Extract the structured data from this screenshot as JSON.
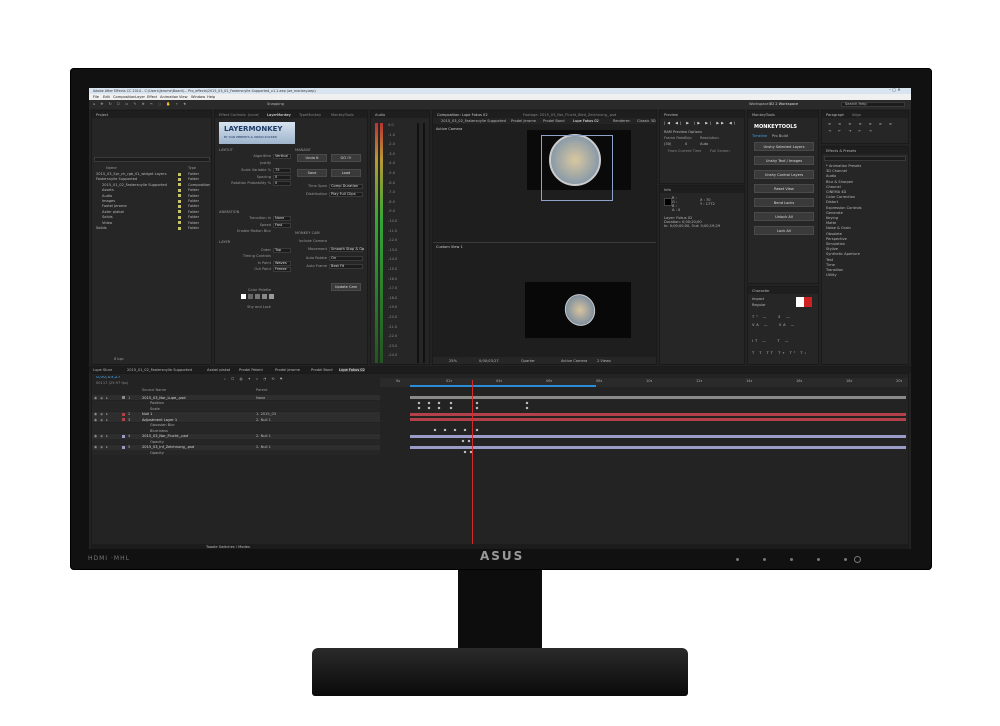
{
  "window": {
    "title": "Adobe After Effects CC 2014 - C:\\Users\\Jerome\\Board\\... Pro_effects\\2015_03_02_Fastersnylie-Supported_v1.1.aep (ae_monkey.aep)",
    "menu": [
      "File",
      "Edit",
      "Composition",
      "Layer",
      "Effect",
      "Animation",
      "View",
      "Window",
      "Help"
    ],
    "snapping": "Snapping",
    "workspace_label": "Workspace:",
    "workspace_value": "3D 2 Workspace",
    "search_help": "Search Help"
  },
  "project": {
    "tab": "Project",
    "col_name": "Name",
    "col_type": "Type",
    "items": [
      {
        "name": "2015_03_Spr_ch_rgb_01_widget Layers",
        "type": "Folder"
      },
      {
        "name": "Fastersnylie Supported",
        "type": "Folder"
      },
      {
        "name": "2015_01_02_Fastersnylie Supported",
        "type": "Composition"
      },
      {
        "name": "Assets",
        "type": "Folder"
      },
      {
        "name": "Audio",
        "type": "Folder"
      },
      {
        "name": "Images",
        "type": "Folder"
      },
      {
        "name": "Footel Jerome",
        "type": "Folder"
      },
      {
        "name": "Axter plakat",
        "type": "Folder"
      },
      {
        "name": "Solids",
        "type": "Folder"
      },
      {
        "name": "Video",
        "type": "Folder"
      },
      {
        "name": "Solids",
        "type": "Folder"
      }
    ],
    "bpc": "8 bpc"
  },
  "layermonkey": {
    "tabs": [
      "Effect Controls: (none)",
      "LayerMonkey",
      "TypeMonkey",
      "MonkeyTools"
    ],
    "logo": "LAYERMONKEY",
    "byline": "BY DAN EBBERTS & ORRIN ZUCKER",
    "sections": {
      "layout": "LAYOUT",
      "animation": "ANIMATION",
      "layer": "LAYER",
      "manage": "MANAGE",
      "monkey_cam": "MONKEY CAM"
    },
    "fields": [
      {
        "label": "Algorithm",
        "value": "Vertical"
      },
      {
        "label": "Justify",
        "value": ""
      },
      {
        "label": "Scale Variable %",
        "value": "75"
      },
      {
        "label": "Spacing",
        "value": "0"
      },
      {
        "label": "Rotation Probability %",
        "value": "0"
      },
      {
        "label": "Transition In",
        "value": "None"
      },
      {
        "label": "Speed",
        "value": "Fast"
      },
      {
        "label": "Enable Motion Blur",
        "value": ""
      },
      {
        "label": "Order",
        "value": "Top"
      },
      {
        "label": "Timing Controls",
        "value": ""
      },
      {
        "label": "In Point",
        "value": "Waves"
      },
      {
        "label": "Out Point",
        "value": "Freeze"
      },
      {
        "label": "Color Palette",
        "value": ""
      },
      {
        "label": "Shy and Lock",
        "value": ""
      }
    ],
    "buttons": [
      "Undo It",
      "GO !!!",
      "Save",
      "Load",
      "Update Cam"
    ],
    "right_fields": [
      {
        "label": "Time Span",
        "value": "Comp Duration"
      },
      {
        "label": "Distribution",
        "value": "Play Full Clips"
      },
      {
        "label": "Include Camera",
        "value": ""
      },
      {
        "label": "Movement",
        "value": "Smooth Stop & Go"
      },
      {
        "label": "Auto Rotate",
        "value": "On"
      },
      {
        "label": "Auto Frame",
        "value": "Best Fit"
      }
    ]
  },
  "audio": {
    "tab": "Audio",
    "levels": [
      "0.0",
      "-1.0",
      "-2.0",
      "-3.0",
      "-4.0",
      "-5.0",
      "-6.0",
      "-7.0",
      "-8.0",
      "-9.0",
      "-10.0",
      "-11.0",
      "-12.0",
      "-13.0",
      "-14.0",
      "-15.0",
      "-16.0",
      "-17.0",
      "-18.0",
      "-19.0",
      "-20.0",
      "-21.0",
      "-22.0",
      "-23.0",
      "-24.0"
    ]
  },
  "viewer": {
    "tab_comp": "Composition: Lupe Fokus 02",
    "tab_footage": "Footage: 2015_03_Nor_Flucht_Bled_Zeichnung_.psd",
    "sub_tabs": [
      "2015_03_02_Fastersnylie Supported",
      "Prodel Jerome",
      "Prodel Band",
      "Lupe Fokus 02"
    ],
    "renderer": "Renderer:",
    "renderer_value": "Classic 3D",
    "active_camera": "Active Camera",
    "custom_view": "Custom View 1",
    "zoom": "25%",
    "timecode": "0;00;03;27",
    "resolution": "Quarter",
    "camera": "Active Camera",
    "views": "2 Views"
  },
  "preview": {
    "tab": "Preview",
    "ram_options": "RAM Preview Options",
    "frame_rate_label": "Frame Rate",
    "skip_label": "Skip",
    "resolution_label": "Resolution",
    "frame_rate": "(30)",
    "skip": "0",
    "resolution": "Auto",
    "from_current": "From Current Time",
    "full_screen": "Full Screen"
  },
  "info": {
    "tab": "Info",
    "rgb": [
      "R :",
      "G :",
      "B :",
      "A : 0"
    ],
    "xy": [
      "X : 70",
      "Y : 1772"
    ],
    "layer": "Layer: Fokus 02",
    "duration": "Duration: 0;00;20;00",
    "inout": "In: 0;00;00;00, Out: 0;00;19;29"
  },
  "monkeytools": {
    "tab": "MonkeyTools",
    "logo": "MONKEYTOOLS",
    "tabs": [
      "Timeline",
      "Pro Build"
    ],
    "buttons": [
      "Unshy Selected Layers",
      "Unshy Text / Images",
      "Unshy Control Layers",
      "Reset View",
      "Bend Locks",
      "Unlock All",
      "Lock All"
    ]
  },
  "paragraph": {
    "tabs": [
      "Paragraph",
      "Align"
    ]
  },
  "character": {
    "tab": "Character",
    "font": "Impact",
    "style": "Regular",
    "size_items": [
      "px",
      "px",
      "px",
      "px"
    ]
  },
  "effects": {
    "tab": "Effects & Presets",
    "items": [
      "* Animation Presets",
      "3D Channel",
      "Audio",
      "Blur & Sharpen",
      "Channel",
      "CINEMA 4D",
      "Color Correction",
      "Distort",
      "Expression Controls",
      "Generate",
      "Keying",
      "Matte",
      "Noise & Grain",
      "Obsolete",
      "Perspective",
      "Simulation",
      "Stylize",
      "Synthetic Aperture",
      "Text",
      "Time",
      "Transition",
      "Utility"
    ]
  },
  "timeline": {
    "tabs": [
      "Lupe Sturz",
      "2015_01_02_Fastersnylie Supported",
      "Axstel plakat",
      "Prodel Patent",
      "Prodel Jerome",
      "Prodel Band",
      "Lupe Fokus 02"
    ],
    "timecode": "0;00;03;27",
    "fps": "00117 (29.97 fps)",
    "col_source": "Source Name",
    "col_parent": "Parent",
    "ruler": [
      "0s",
      "02s",
      "04s",
      "06s",
      "08s",
      "10s",
      "12s",
      "14s",
      "16s",
      "18s",
      "20s"
    ],
    "layers": [
      {
        "num": "1",
        "name": "2015_03_Nor_Lupe_.psd",
        "parent": "None"
      },
      {
        "num": "",
        "name": "Position",
        "parent": ""
      },
      {
        "num": "",
        "name": "Scale",
        "parent": ""
      },
      {
        "num": "2",
        "name": "Null 1",
        "parent": "1. 2015_03"
      },
      {
        "num": "3",
        "name": "Adjustment Layer 1",
        "parent": "2. Null 1"
      },
      {
        "num": "",
        "name": "Gaussian Blur",
        "parent": ""
      },
      {
        "num": "",
        "name": "Blurriness",
        "parent": ""
      },
      {
        "num": "4",
        "name": "2015_03_Nor_Flucht_.psd",
        "parent": "2. Null 1"
      },
      {
        "num": "",
        "name": "Opacity",
        "parent": ""
      },
      {
        "num": "5",
        "name": "2015_03_Inf_Zeichnung_.psd",
        "parent": "2. Null 1"
      },
      {
        "num": "",
        "name": "Opacity",
        "parent": ""
      }
    ],
    "footer": "Toggle Switches / Modes"
  },
  "monitor": {
    "logos": "HDMI ·MHL",
    "brand": "ASUS"
  },
  "colors": {
    "bg": "#232323",
    "panel": "#262626",
    "accent": "#2b8cd8",
    "label_yellow": "#c8c26a",
    "playhead": "#d62a2a",
    "track_red": "#b3414a",
    "track_lilac": "#9b9bc8",
    "track_gray": "#8a8a8a"
  }
}
